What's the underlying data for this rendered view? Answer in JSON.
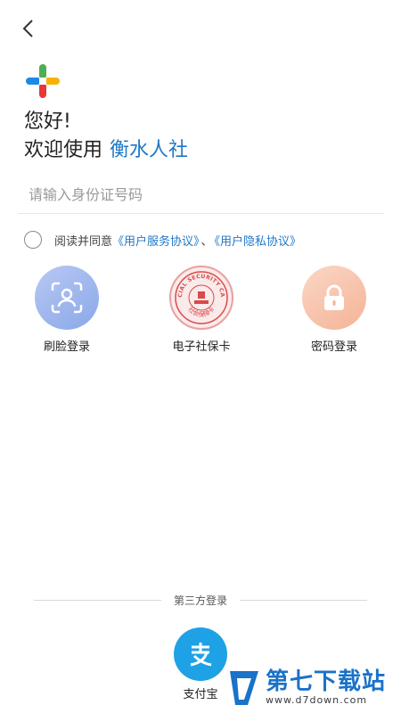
{
  "header": {
    "back_icon": "chevron-left-icon"
  },
  "app": {
    "logo_icon": "colorful-plus-logo"
  },
  "greeting": {
    "line1": "您好!",
    "line2_prefix": "欢迎使用",
    "brand_name": "衡水人社"
  },
  "login_form": {
    "id_placeholder": "请输入身份证号码",
    "id_value": ""
  },
  "agreement": {
    "checked": false,
    "prefix": "阅读并同意",
    "terms_link": "《用户服务协议》",
    "separator": "、",
    "privacy_link": "《用户隐私协议》"
  },
  "login_methods": [
    {
      "label": "刷脸登录",
      "icon": "face-scan-icon"
    },
    {
      "label": "电子社保卡",
      "icon": "social-security-card-seal",
      "seal_text_top": "SOCIAL SECURITY CARD",
      "seal_text_bottom": "社会保障卡"
    },
    {
      "label": "密码登录",
      "icon": "lock-icon"
    }
  ],
  "third_party": {
    "divider_label": "第三方登录",
    "alipay_label": "支付宝",
    "alipay_icon": "alipay-icon"
  },
  "watermark": {
    "title": "第七下载站",
    "url": "www.d7down.com"
  },
  "colors": {
    "brand_blue": "#1f78c8",
    "alipay_blue": "#1fa1e6",
    "face_blue": "#8aa8e8",
    "password_orange": "#f4b395",
    "seal_red": "#d94a4a"
  }
}
